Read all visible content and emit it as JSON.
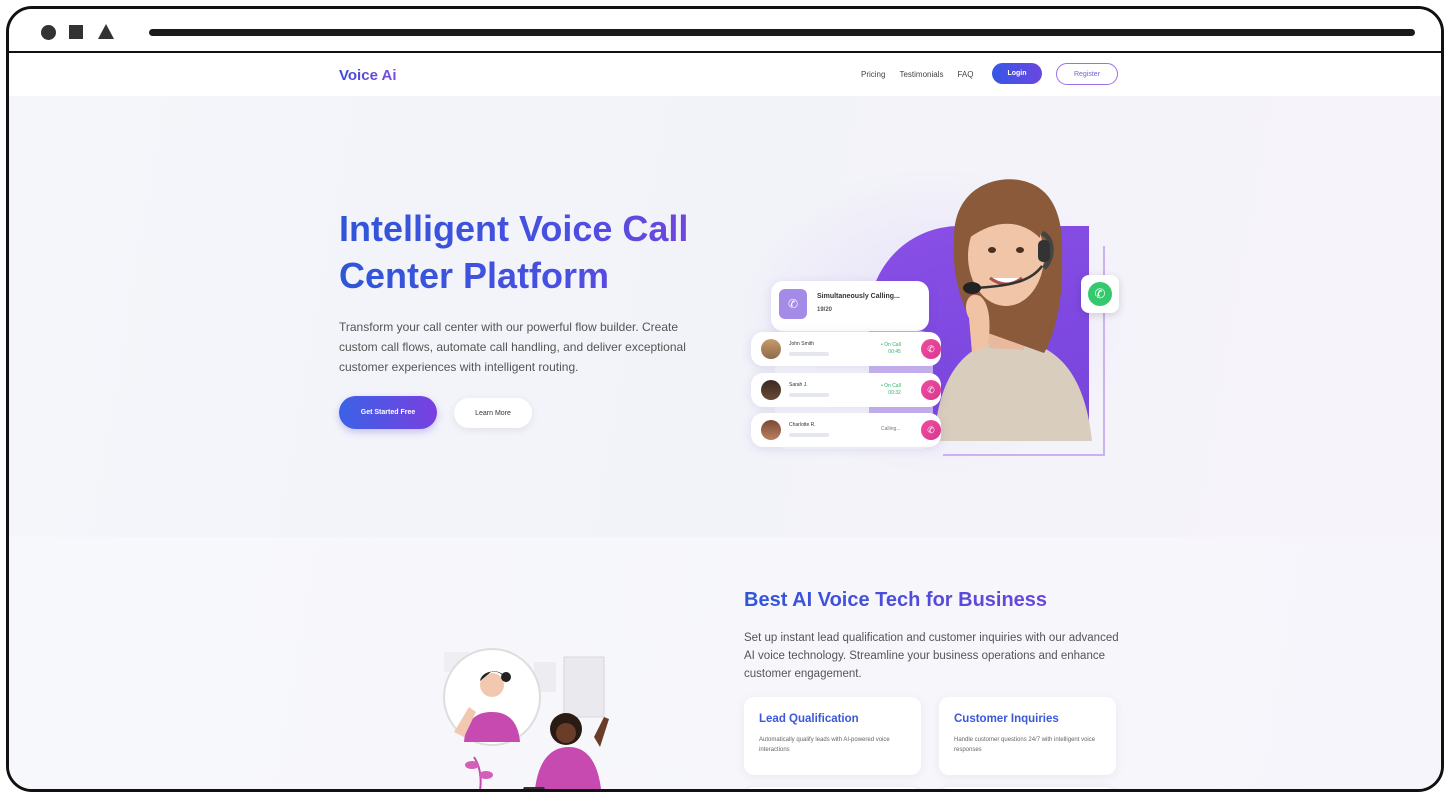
{
  "browser": {
    "controls": [
      "circle-icon",
      "square-icon",
      "triangle-icon"
    ]
  },
  "nav": {
    "brand": "Voice Ai",
    "links": [
      "Pricing",
      "Testimonials",
      "FAQ"
    ],
    "login": "Login",
    "register": "Register"
  },
  "hero": {
    "title": "Intelligent Voice Call Center Platform",
    "description": "Transform your call center with our powerful flow builder. Create custom call flows, automate call handling, and deliver exceptional customer experiences with intelligent routing.",
    "cta_primary": "Get Started Free",
    "cta_secondary": "Learn More",
    "calling_card": {
      "title": "Simultaneously Calling...",
      "count": "19/20"
    },
    "calls": [
      {
        "name": "John Smith",
        "status": "• On Call",
        "time": "00:45"
      },
      {
        "name": "Sarah J.",
        "status": "• On Call",
        "time": "00:32"
      },
      {
        "name": "Charlotte R.",
        "status": "Calling...",
        "time": ""
      }
    ]
  },
  "section2": {
    "title": "Best AI Voice Tech for Business",
    "description": "Set up instant lead qualification and customer inquiries with our advanced AI voice technology. Streamline your business operations and enhance customer engagement.",
    "features": [
      {
        "title": "Lead Qualification",
        "description": "Automatically qualify leads with AI-powered voice interactions"
      },
      {
        "title": "Customer Inquiries",
        "description": "Handle customer questions 24/7 with intelligent voice responses"
      }
    ]
  },
  "colors": {
    "accent": "#3a58d8",
    "purple": "#7b43dc",
    "call_green": "#2db26b",
    "hangup_pink": "#e23f97"
  }
}
